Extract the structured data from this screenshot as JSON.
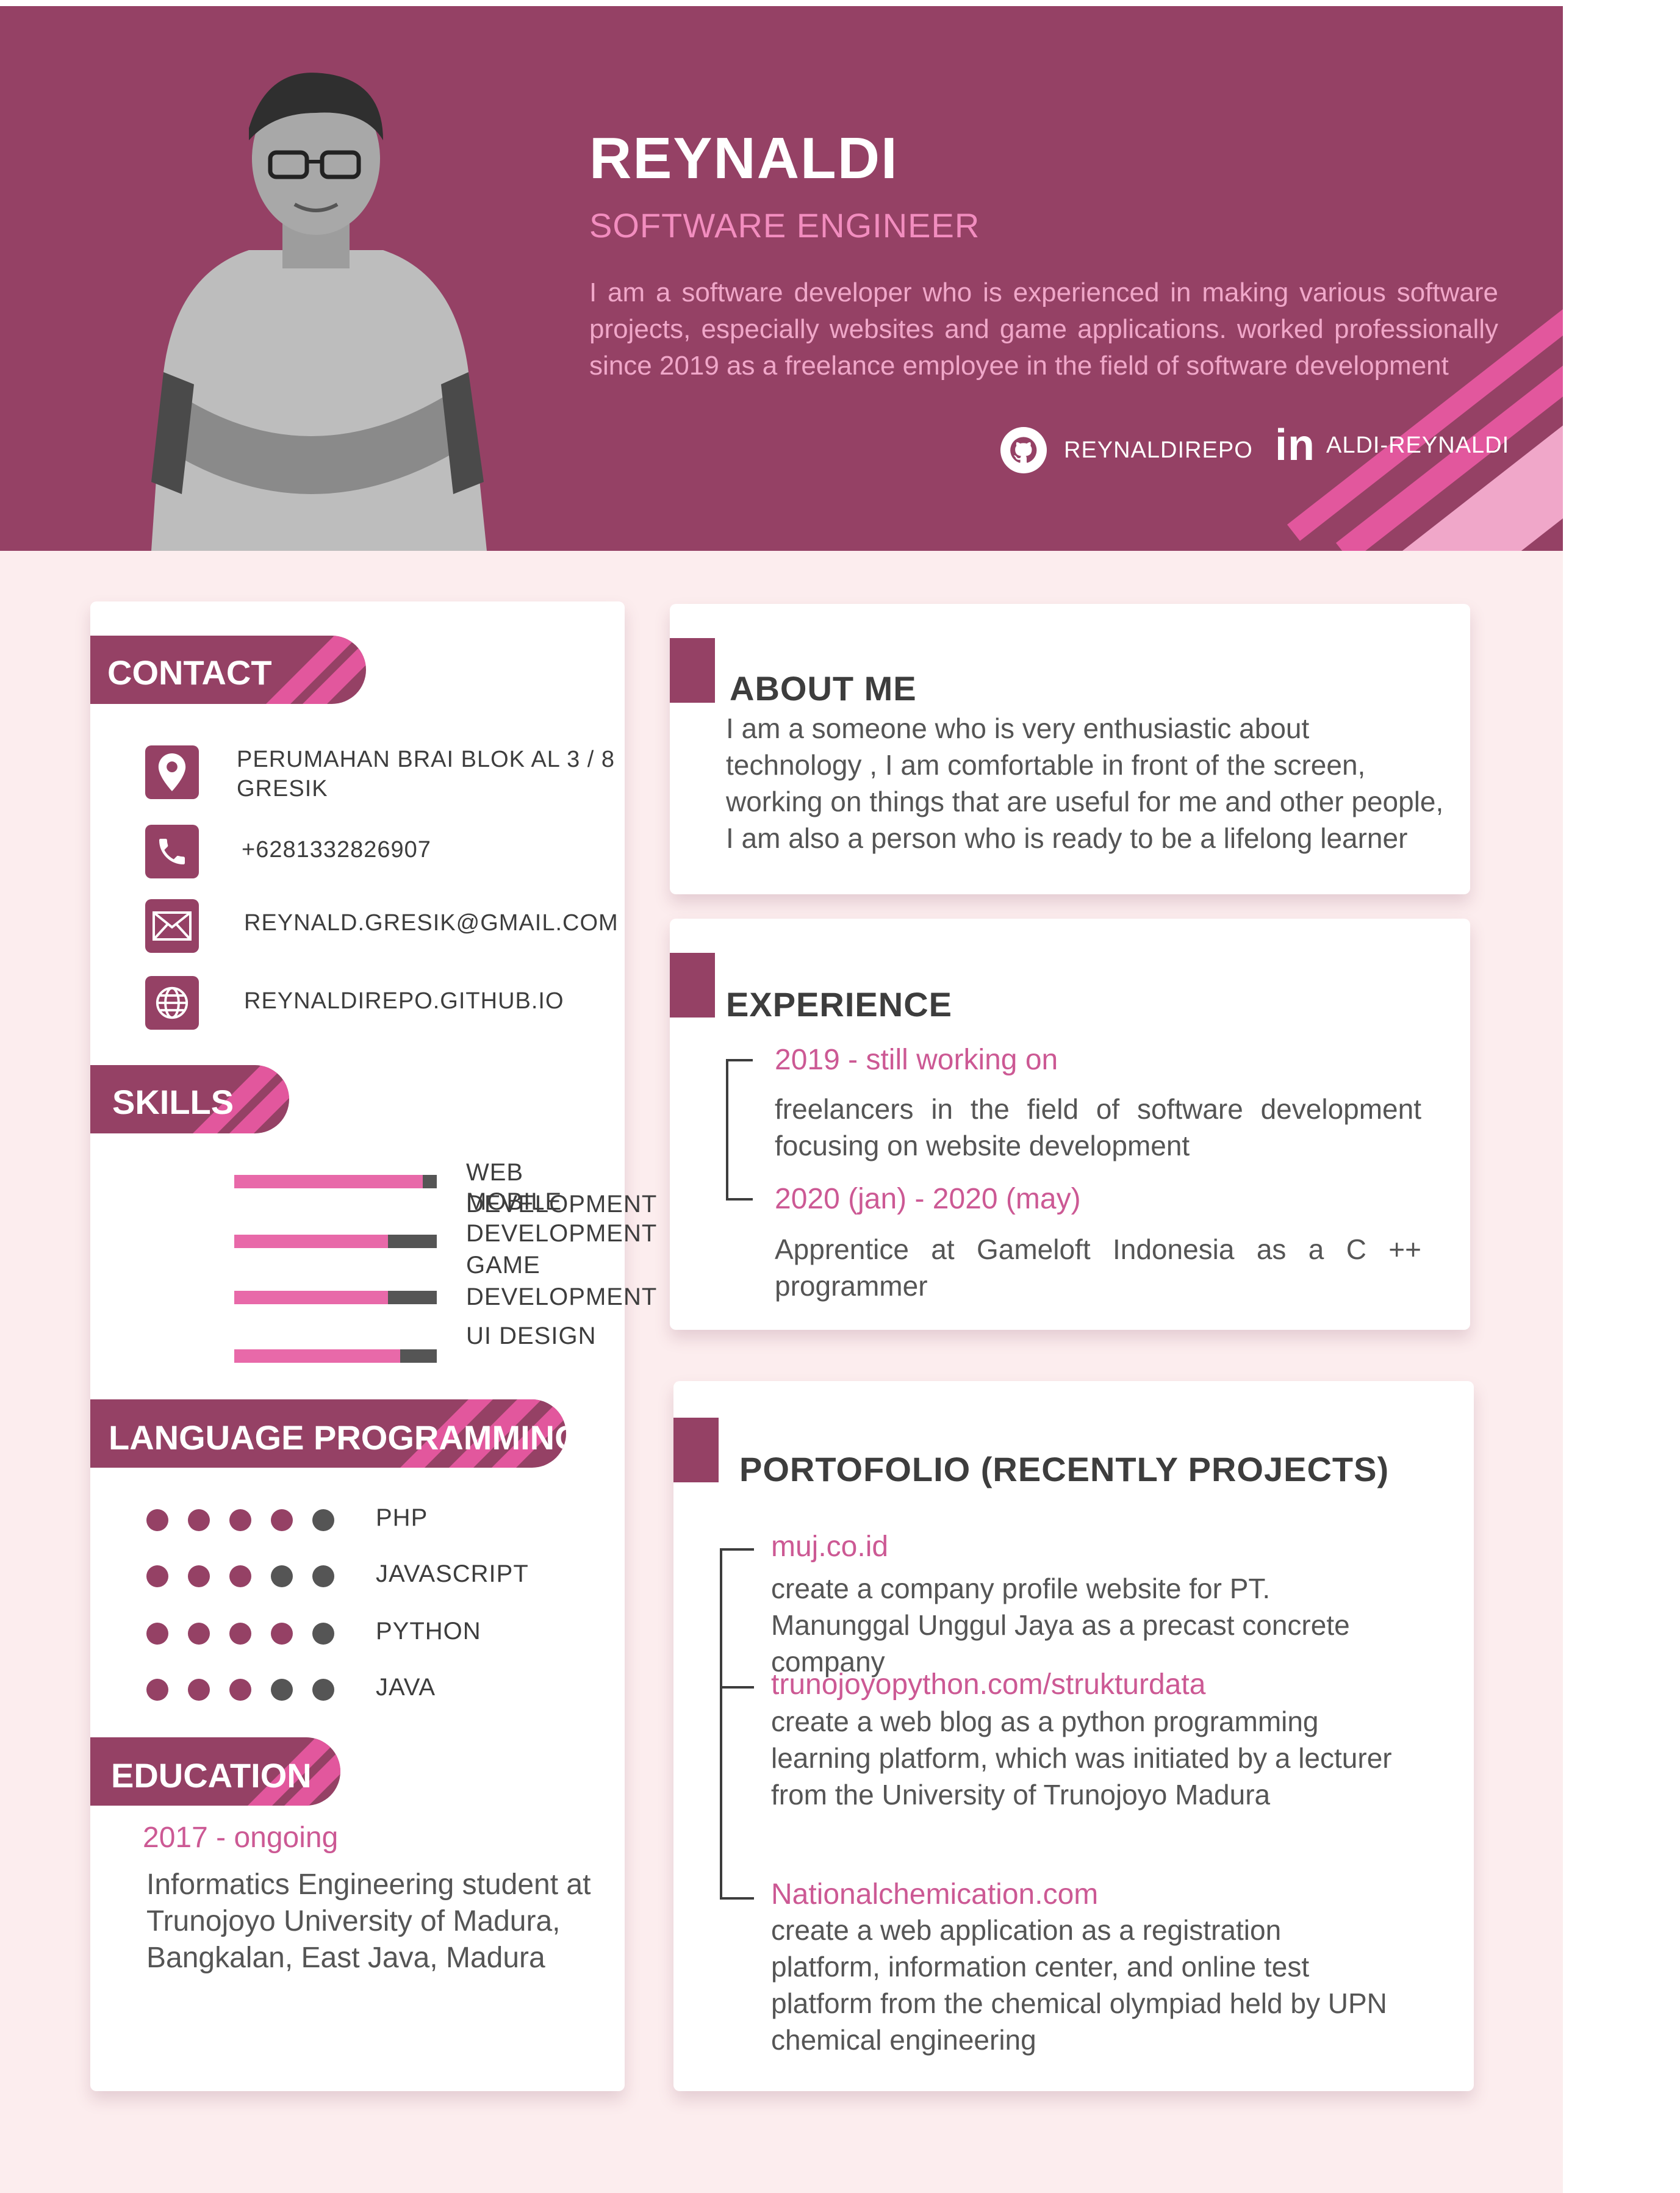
{
  "header": {
    "name": "REYNALDI",
    "role": "SOFTWARE ENGINEER",
    "intro": "I am a software developer who is experienced in making various software projects, especially websites and game applications. worked professionally since 2019 as a freelance employee in the field of software development",
    "github": "REYNALDIREPO",
    "linkedin_icon": "in",
    "linkedin": "ALDI-REYNALDI"
  },
  "contact": {
    "title": "CONTACT",
    "address_line1": "PERUMAHAN BRAI BLOK AL 3  / 8",
    "address_line2": "GRESIK",
    "phone": "+6281332826907",
    "email": "REYNALD.GRESIK@GMAIL.COM",
    "website": "REYNALDIREPO.GITHUB.IO"
  },
  "skills": {
    "title": "SKILLS",
    "items": [
      {
        "label": "WEB DEVELOPMENT",
        "level": 0.93
      },
      {
        "label": "MOBILE\nDEVELOPMENT",
        "level": 0.76
      },
      {
        "label": "GAME\nDEVELOPMENT",
        "level": 0.76
      },
      {
        "label": "UI DESIGN",
        "level": 0.82
      }
    ]
  },
  "languages": {
    "title": "LANGUAGE PROGRAMMING",
    "items": [
      {
        "label": "PHP",
        "rating": 4,
        "max": 5
      },
      {
        "label": "JAVASCRIPT",
        "rating": 3,
        "max": 5
      },
      {
        "label": "PYTHON",
        "rating": 4,
        "max": 5
      },
      {
        "label": "JAVA",
        "rating": 3,
        "max": 5
      }
    ]
  },
  "education": {
    "title": "EDUCATION",
    "year": "2017 - ongoing",
    "text": "Informatics Engineering student at Trunojoyo University of Madura, Bangkalan, East Java, Madura"
  },
  "about": {
    "title": "ABOUT ME",
    "text": "I am a someone who is very enthusiastic about technology , I am comfortable in front of the screen, working on things that are useful for me and other people, I am also a person who is ready to be a lifelong learner"
  },
  "experience": {
    "title": "EXPERIENCE",
    "items": [
      {
        "period": "2019 - still working on",
        "text": "freelancers in the field of software development focusing on website development"
      },
      {
        "period": "2020 (jan) - 2020 (may)",
        "text": "Apprentice at Gameloft Indonesia as a C ++ programmer"
      }
    ]
  },
  "portfolio": {
    "title": "PORTOFOLIO (RECENTLY PROJECTS)",
    "items": [
      {
        "link": "muj.co.id",
        "text": "create a company profile website for PT. Manunggal Unggul Jaya as a precast concrete company"
      },
      {
        "link": "trunojoyopython.com/strukturdata",
        "text": "create a web blog as a python programming learning platform, which was initiated by a lecturer from the University of Trunojoyo Madura"
      },
      {
        "link": "Nationalchemication.com",
        "text": "create a web application as a registration platform, information center, and online test platform from the chemical olympiad held by UPN chemical engineering"
      }
    ]
  },
  "colors": {
    "primary": "#954165",
    "accent": "#e2579d",
    "light_accent": "#f0a7c9",
    "background": "#fcedee",
    "dark": "#555555"
  },
  "icons": [
    "location-icon",
    "phone-icon",
    "mail-icon",
    "globe-icon",
    "github-icon",
    "linkedin-icon"
  ]
}
